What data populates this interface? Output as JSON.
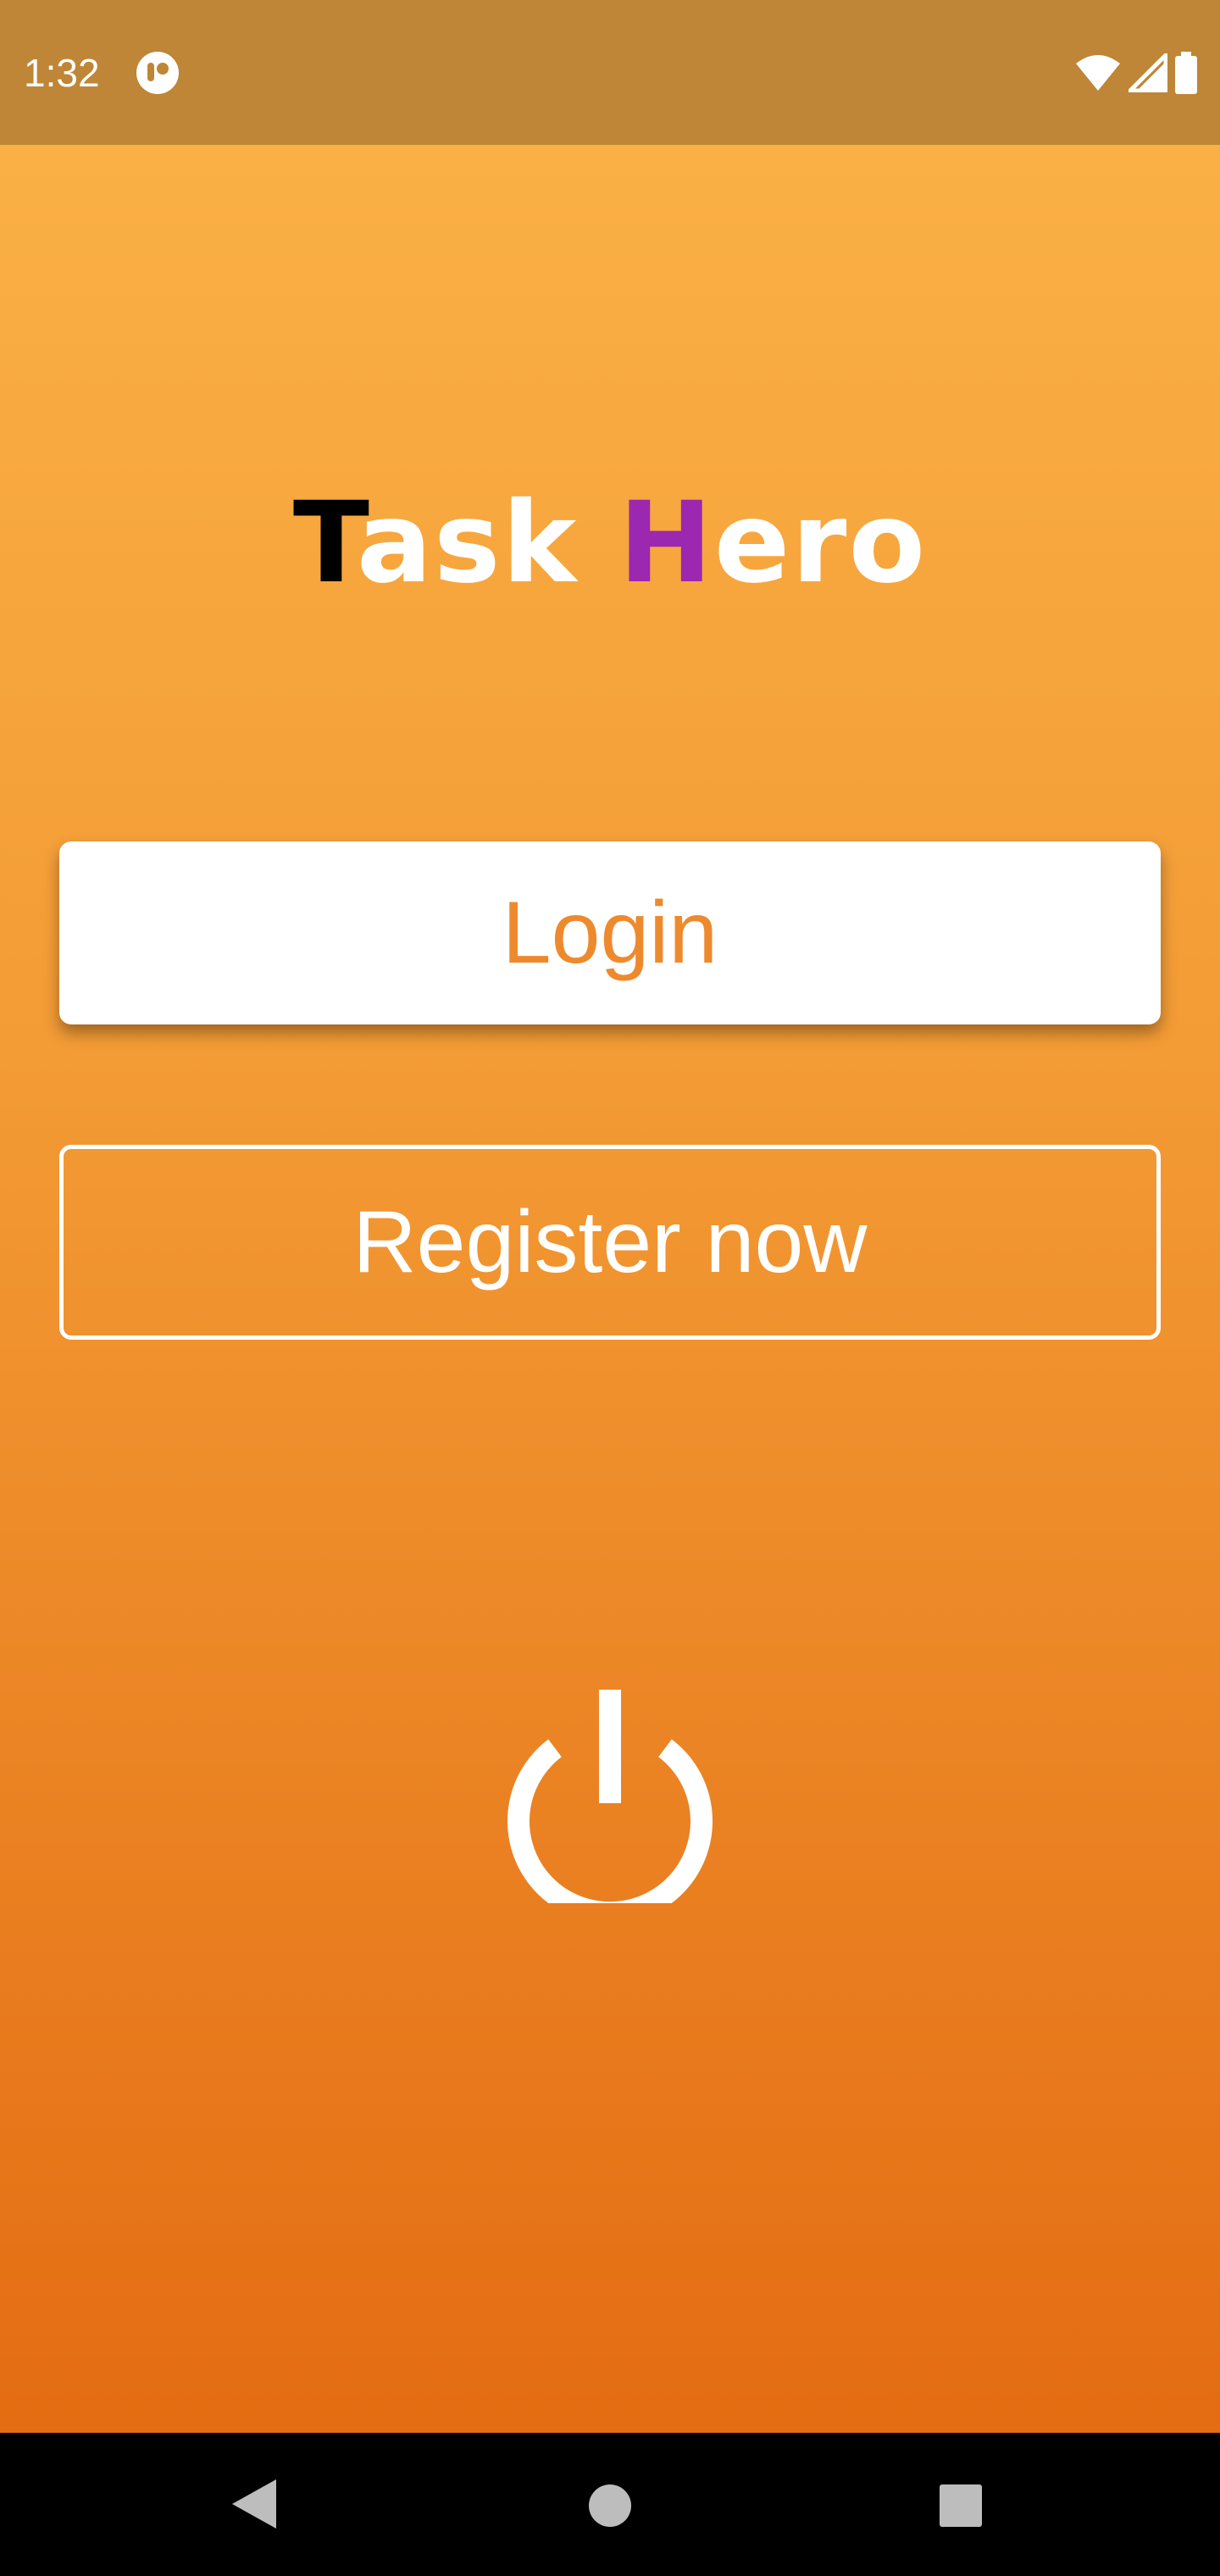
{
  "status_bar": {
    "time": "1:32",
    "icons": [
      "app-notification-icon",
      "wifi-icon",
      "cell-signal-icon",
      "battery-icon"
    ]
  },
  "app": {
    "title_parts": [
      {
        "text": "T",
        "color": "#000000"
      },
      {
        "text": "ask ",
        "color": "#FFFFFF"
      },
      {
        "text": "H",
        "color": "#9C27B0"
      },
      {
        "text": "ero",
        "color": "#FFFFFF"
      }
    ]
  },
  "buttons": {
    "login_label": "Login",
    "register_label": "Register now"
  },
  "icons": {
    "power": "power-icon"
  },
  "nav_bar": {
    "icons": [
      "back-icon",
      "home-icon",
      "recents-icon"
    ]
  },
  "colors": {
    "status_bar": "#BE8636",
    "gradient_top": "#FAB045",
    "gradient_bottom": "#E46C12",
    "login_text": "#EE8A2E",
    "accent_purple": "#9C27B0"
  }
}
